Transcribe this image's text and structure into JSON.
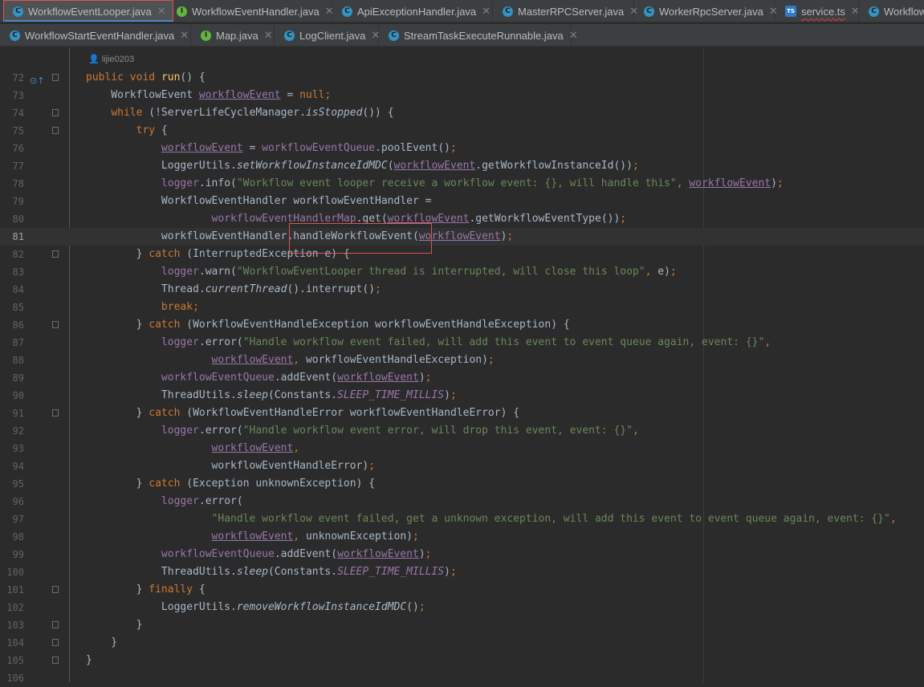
{
  "tabs_row1": [
    {
      "label": "WorkflowEventLooper.java",
      "icon": "c"
    },
    {
      "label": "WorkflowEventHandler.java",
      "icon": "i"
    },
    {
      "label": "ApiExceptionHandler.java",
      "icon": "c"
    },
    {
      "label": "MasterRPCServer.java",
      "icon": "c"
    },
    {
      "label": "WorkerRpcServer.java",
      "icon": "c"
    },
    {
      "label": "service.ts",
      "icon": "ts"
    },
    {
      "label": "Workflow",
      "icon": "c"
    }
  ],
  "tabs_row2": [
    {
      "label": "WorkflowStartEventHandler.java",
      "icon": "c"
    },
    {
      "label": "Map.java",
      "icon": "i"
    },
    {
      "label": "LogClient.java",
      "icon": "c"
    },
    {
      "label": "StreamTaskExecuteRunnable.java",
      "icon": "c"
    }
  ],
  "editor": {
    "author": "lijie0203",
    "lines": [
      {
        "n": "72",
        "code": "public void run() {"
      },
      {
        "n": "73",
        "code": "    WorkflowEvent workflowEvent = null;"
      },
      {
        "n": "74",
        "code": "    while (!ServerLifeCycleManager.isStopped()) {"
      },
      {
        "n": "75",
        "code": "        try {"
      },
      {
        "n": "76",
        "code": "            workflowEvent = workflowEventQueue.poolEvent();"
      },
      {
        "n": "77",
        "code": "            LoggerUtils.setWorkflowInstanceIdMDC(workflowEvent.getWorkflowInstanceId());"
      },
      {
        "n": "78",
        "code": "            logger.info(\"Workflow event looper receive a workflow event: {}, will handle this\", workflowEvent);"
      },
      {
        "n": "79",
        "code": "            WorkflowEventHandler workflowEventHandler ="
      },
      {
        "n": "80",
        "code": "                    workflowEventHandlerMap.get(workflowEvent.getWorkflowEventType());"
      },
      {
        "n": "81",
        "code": "            workflowEventHandler.handleWorkflowEvent(workflowEvent);"
      },
      {
        "n": "82",
        "code": "        } catch (InterruptedException e) {"
      },
      {
        "n": "83",
        "code": "            logger.warn(\"WorkflowEventLooper thread is interrupted, will close this loop\", e);"
      },
      {
        "n": "84",
        "code": "            Thread.currentThread().interrupt();"
      },
      {
        "n": "85",
        "code": "            break;"
      },
      {
        "n": "86",
        "code": "        } catch (WorkflowEventHandleException workflowEventHandleException) {"
      },
      {
        "n": "87",
        "code": "            logger.error(\"Handle workflow event failed, will add this event to event queue again, event: {}\","
      },
      {
        "n": "88",
        "code": "                    workflowEvent, workflowEventHandleException);"
      },
      {
        "n": "89",
        "code": "            workflowEventQueue.addEvent(workflowEvent);"
      },
      {
        "n": "90",
        "code": "            ThreadUtils.sleep(Constants.SLEEP_TIME_MILLIS);"
      },
      {
        "n": "91",
        "code": "        } catch (WorkflowEventHandleError workflowEventHandleError) {"
      },
      {
        "n": "92",
        "code": "            logger.error(\"Handle workflow event error, will drop this event, event: {}\","
      },
      {
        "n": "93",
        "code": "                    workflowEvent,"
      },
      {
        "n": "94",
        "code": "                    workflowEventHandleError);"
      },
      {
        "n": "95",
        "code": "        } catch (Exception unknownException) {"
      },
      {
        "n": "96",
        "code": "            logger.error("
      },
      {
        "n": "97",
        "code": "                    \"Handle workflow event failed, get a unknown exception, will add this event to event queue again, event: {}\","
      },
      {
        "n": "98",
        "code": "                    workflowEvent, unknownException);"
      },
      {
        "n": "99",
        "code": "            workflowEventQueue.addEvent(workflowEvent);"
      },
      {
        "n": "100",
        "code": "            ThreadUtils.sleep(Constants.SLEEP_TIME_MILLIS);"
      },
      {
        "n": "101",
        "code": "        } finally {"
      },
      {
        "n": "102",
        "code": "            LoggerUtils.removeWorkflowInstanceIdMDC();"
      },
      {
        "n": "103",
        "code": "        }"
      },
      {
        "n": "104",
        "code": "    }"
      },
      {
        "n": "105",
        "code": "}"
      },
      {
        "n": "106",
        "code": ""
      }
    ]
  }
}
